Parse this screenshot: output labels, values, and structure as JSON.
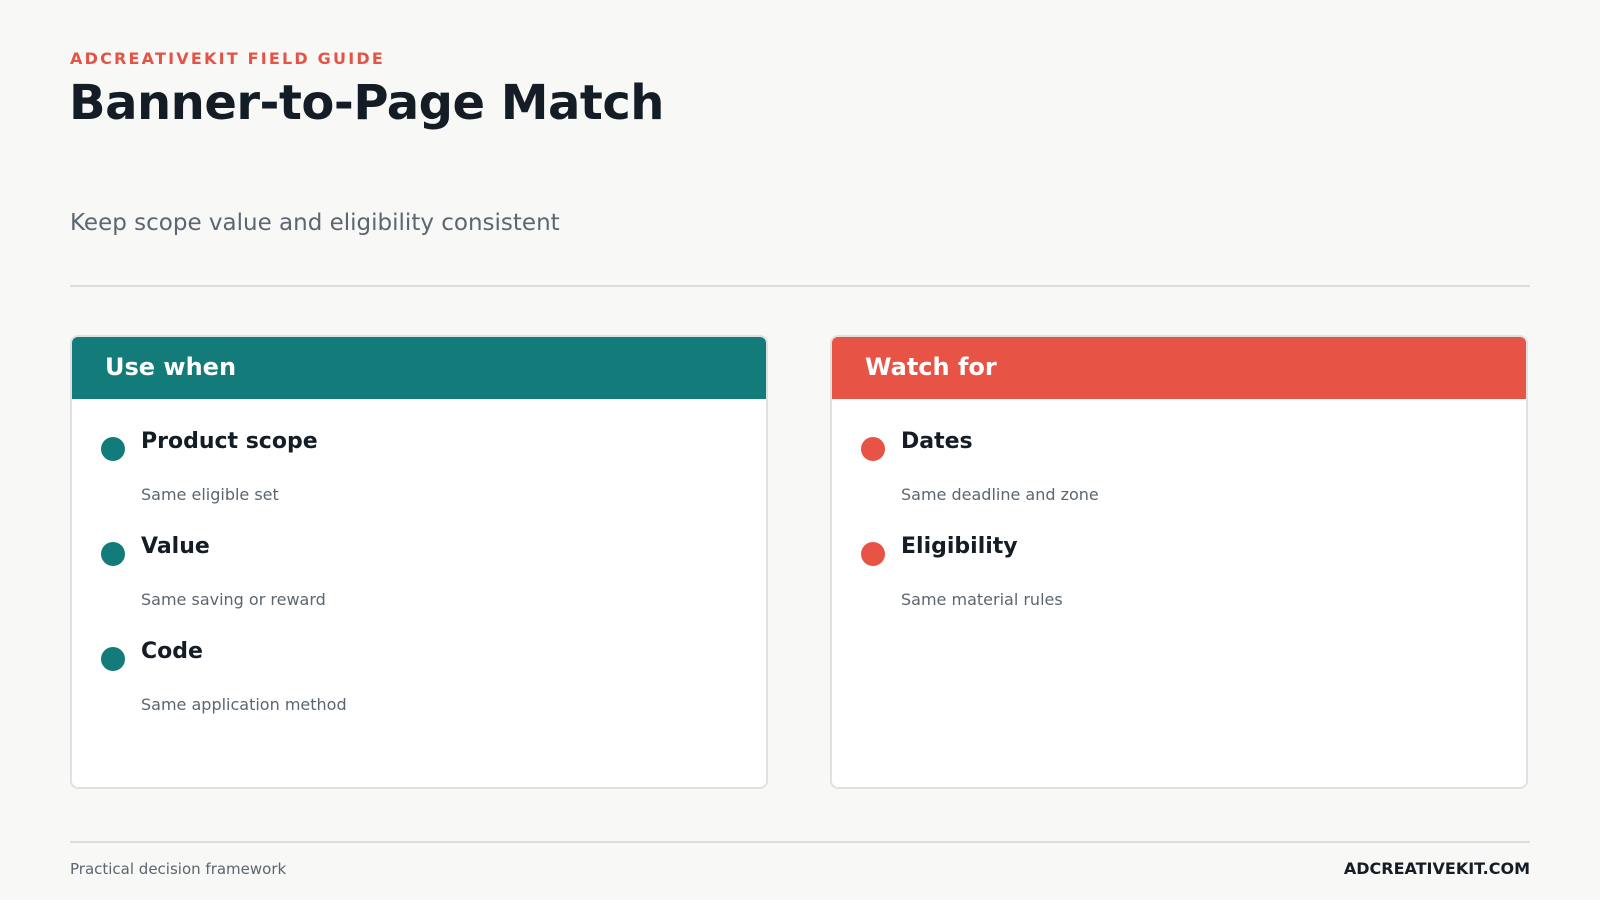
{
  "header": {
    "eyebrow": "ADCREATIVEKIT FIELD GUIDE",
    "title": "Banner-to-Page Match",
    "subtitle": "Keep scope value and eligibility consistent"
  },
  "cards": [
    {
      "heading": "Use when",
      "accent": "#137b7a",
      "items": [
        {
          "title": "Product scope",
          "description": "Same eligible set"
        },
        {
          "title": "Value",
          "description": "Same saving or reward"
        },
        {
          "title": "Code",
          "description": "Same application method"
        }
      ]
    },
    {
      "heading": "Watch for",
      "accent": "#e75344",
      "items": [
        {
          "title": "Dates",
          "description": "Same deadline and zone"
        },
        {
          "title": "Eligibility",
          "description": "Same material rules"
        }
      ]
    }
  ],
  "footer": {
    "tagline": "Practical decision framework",
    "site": "ADCREATIVEKIT.COM"
  }
}
